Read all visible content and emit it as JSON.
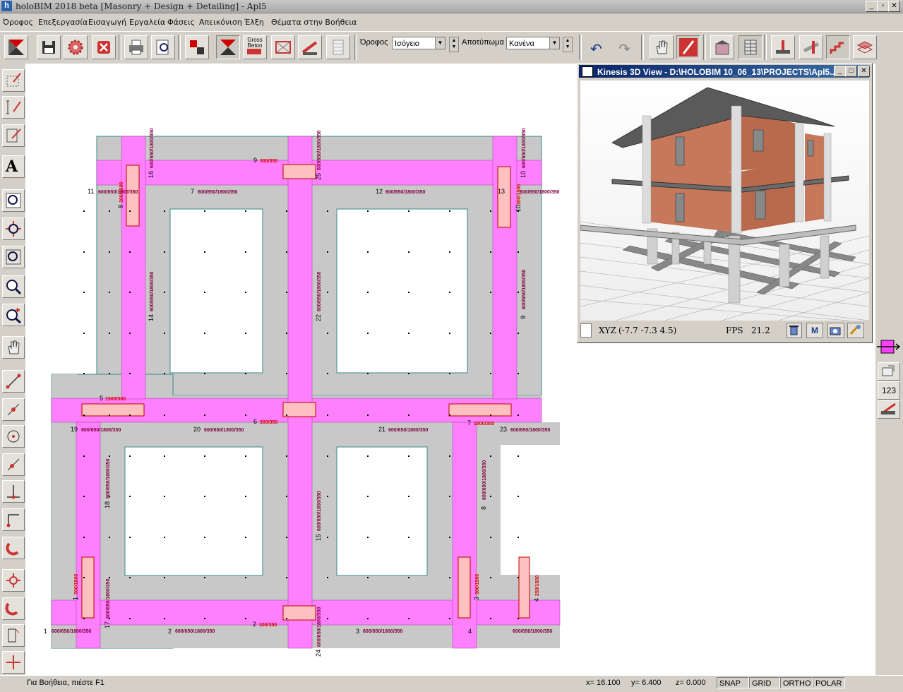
{
  "window": {
    "title": "holoBIM 2018 beta [Masonry + Design + Detailing] - Apl5",
    "icon_letter": "h"
  },
  "menu": [
    "Όροφος",
    "Επεξεργασία",
    "Εισαγωγή",
    "Εργαλεία",
    "Φάσεις",
    "Απεικόνιση",
    "Έλξη",
    "Θέματα στην Βοήθεια"
  ],
  "toolbar": {
    "floor_label": "Όροφος",
    "floor_value": "Ισόγειο",
    "footprint_label": "Αποτύπωμα",
    "footprint_value": "Κανένα",
    "gross_button_label": "Gross Beton"
  },
  "view3d": {
    "title": "Kinesis 3D View - D:\\HOLOBIM 10_06_13\\PROJECTS\\Apl5...",
    "xyz_label": "XYZ",
    "xyz_value": "(-7.7 -7.3 4.5)",
    "fps_label": "FPS",
    "fps_value": "21.2",
    "m_button": "M"
  },
  "right_toolbar": {
    "numbers_button": "123"
  },
  "plan": {
    "colors": {
      "foundation": "#c8c8c8",
      "beam": "#ff80ff",
      "column": "#ffc0c0",
      "column_border": "#c00000",
      "beam_label": "#800040",
      "column_label": "#e00000",
      "edge": "#3a8a8a"
    },
    "beam_labels": [
      {
        "n": "1",
        "text": "600/650/1800/350"
      },
      {
        "n": "2",
        "text": "600/650/1800/350"
      },
      {
        "n": "3",
        "text": "600/650/1800/350"
      },
      {
        "n": "4",
        "text": "600/650/1800/350"
      },
      {
        "n": "7",
        "text": "600/650/1800/350"
      },
      {
        "n": "11",
        "text": "600/650/1800/350"
      },
      {
        "n": "12",
        "text": "600/650/1800/350"
      },
      {
        "n": "13",
        "text": "600/650/1800/350"
      },
      {
        "n": "19",
        "text": "600/650/1800/350"
      },
      {
        "n": "20",
        "text": "600/650/1800/350"
      },
      {
        "n": "21",
        "text": "600/650/1800/350"
      },
      {
        "n": "23",
        "text": "600/650/1800/350"
      }
    ],
    "column_labels": [
      {
        "n": "9",
        "text": "300/350"
      },
      {
        "n": "5",
        "text": "1500/300"
      },
      {
        "n": "6",
        "text": "300/350"
      },
      {
        "n": "7",
        "text": "1500/300"
      },
      {
        "n": "2",
        "text": "300/350"
      }
    ],
    "vertical_beam_labels": [
      {
        "n": "16",
        "text": "600/650/1800/350"
      },
      {
        "n": "25",
        "text": "600/650/1800/350"
      },
      {
        "n": "10",
        "text": "600/650/1800/350"
      },
      {
        "n": "14",
        "text": "600/650/1800/350"
      },
      {
        "n": "22",
        "text": "600/650/1800/350"
      },
      {
        "n": "9",
        "text": "600/650/1800/350"
      },
      {
        "n": "18",
        "text": "600/650/1800/350"
      },
      {
        "n": "15",
        "text": "600/650/1800/350"
      },
      {
        "n": "8",
        "text": "600/650/1800/350"
      },
      {
        "n": "17",
        "text": "600/650/1800/350"
      },
      {
        "n": "24",
        "text": "600/650/1800/350"
      }
    ],
    "vertical_column_labels": [
      {
        "n": "8",
        "text": "300/1500"
      },
      {
        "n": "10",
        "text": "300/1500"
      },
      {
        "n": "1",
        "text": "300/1500"
      },
      {
        "n": "3",
        "text": "300/1500"
      },
      {
        "n": "4",
        "text": "250/1500"
      }
    ]
  },
  "status": {
    "help": "Για Βοήθεια, πιέστε F1",
    "x": "x= 16.100",
    "y": "y= 6.400",
    "z": "z= 0.000",
    "snap": "SNAP",
    "grid": "GRID",
    "ortho": "ORTHO",
    "polar": "POLAR"
  }
}
